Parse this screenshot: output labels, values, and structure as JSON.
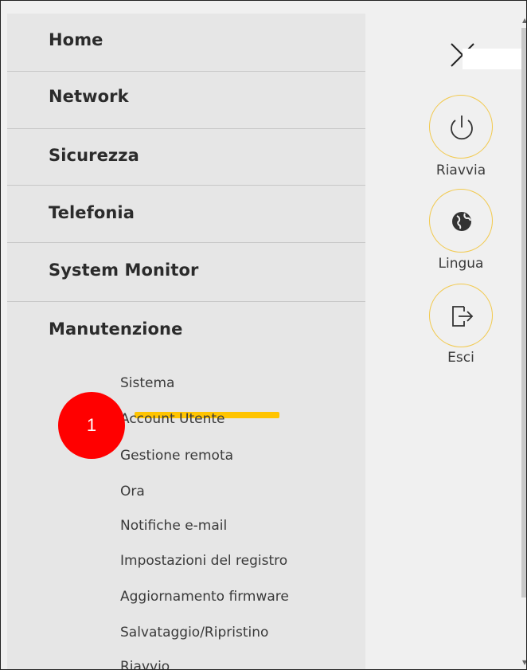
{
  "menu": {
    "items": [
      {
        "label": "Home"
      },
      {
        "label": "Network"
      },
      {
        "label": "Sicurezza"
      },
      {
        "label": "Telefonia"
      },
      {
        "label": "System Monitor"
      },
      {
        "label": "Manutenzione"
      }
    ],
    "submenu": [
      {
        "label": "Sistema"
      },
      {
        "label": "Account Utente"
      },
      {
        "label": "Gestione remota"
      },
      {
        "label": "Ora"
      },
      {
        "label": "Notifiche e-mail"
      },
      {
        "label": "Impostazioni del registro"
      },
      {
        "label": "Aggiornamento firmware"
      },
      {
        "label": "Salvataggio/Ripristino"
      },
      {
        "label": "Riavvio"
      }
    ]
  },
  "annotation": {
    "step_number": "1",
    "badge_color": "#ff0000",
    "highlight_color": "#ffc400"
  },
  "side_panel": {
    "close_icon": "close-icon",
    "buttons": [
      {
        "label": "Riavvia",
        "icon": "power-icon"
      },
      {
        "label": "Lingua",
        "icon": "globe-icon"
      },
      {
        "label": "Esci",
        "icon": "logout-icon"
      }
    ],
    "accent_color": "#f2c94c"
  }
}
